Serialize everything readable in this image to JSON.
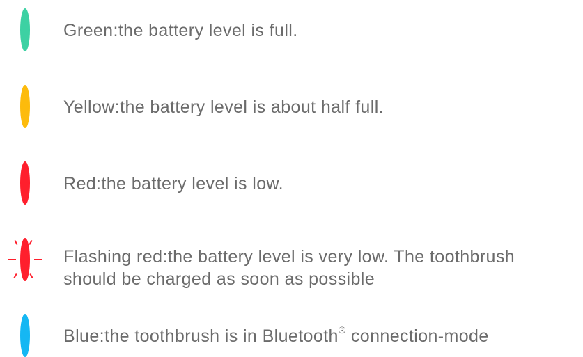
{
  "colors": {
    "green": "#3dd1a3",
    "yellow": "#fdbb0c",
    "red": "#ff1f2d",
    "flashing_red": "#ff1f2d",
    "blue": "#15b7f3",
    "text": "#6b6b6b"
  },
  "items": [
    {
      "icon": "green-led-icon",
      "text": "Green:the battery level is full."
    },
    {
      "icon": "yellow-led-icon",
      "text": "Yellow:the battery level is about half full."
    },
    {
      "icon": "red-led-icon",
      "text": "Red:the battery level is low."
    },
    {
      "icon": "flashing-red-led-icon",
      "text_line1": "Flashing red:the battery level is very low. The toothbrush",
      "text_line2": "should be charged as soon as possible"
    },
    {
      "icon": "blue-led-icon",
      "text_before": "Blue:the toothbrush is in Bluetooth",
      "registered_mark": "®",
      "text_after": " connection-mode"
    }
  ]
}
